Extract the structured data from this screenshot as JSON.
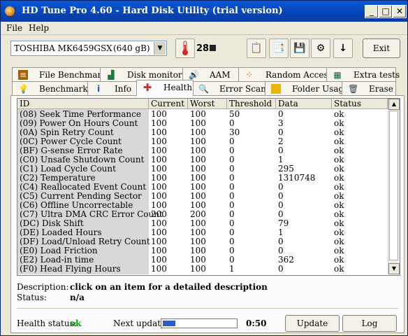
{
  "window": {
    "title": "HD Tune Pro 4.60 - Hard Disk Utility (trial version)"
  },
  "menu": {
    "file": "File",
    "help": "Help"
  },
  "toolbar": {
    "drive_name": "TOSHIBA MK6459GSX",
    "drive_size": "(640 gB)",
    "temperature": "28",
    "temperature_unit_icon": "celsius-icon",
    "exit_label": "Exit"
  },
  "tabs_top": [
    "File Benchmark",
    "Disk monitor",
    "AAM",
    "Random Access",
    "Extra tests"
  ],
  "tabs_bottom": [
    "Benchmark",
    "Info",
    "Health",
    "Error Scan",
    "Folder Usage",
    "Erase"
  ],
  "active_tab": "Health",
  "table": {
    "headers": [
      "ID",
      "Current",
      "Worst",
      "Threshold",
      "Data",
      "Status"
    ],
    "rows": [
      [
        "(08) Seek Time Performance",
        "100",
        "100",
        "50",
        "0",
        "ok"
      ],
      [
        "(09) Power On Hours Count",
        "100",
        "100",
        "0",
        "3",
        "ok"
      ],
      [
        "(0A) Spin Retry Count",
        "100",
        "100",
        "30",
        "0",
        "ok"
      ],
      [
        "(0C) Power Cycle Count",
        "100",
        "100",
        "0",
        "2",
        "ok"
      ],
      [
        "(BF) G-sense Error Rate",
        "100",
        "100",
        "0",
        "0",
        "ok"
      ],
      [
        "(C0) Unsafe Shutdown Count",
        "100",
        "100",
        "0",
        "1",
        "ok"
      ],
      [
        "(C1) Load Cycle Count",
        "100",
        "100",
        "0",
        "295",
        "ok"
      ],
      [
        "(C2) Temperature",
        "100",
        "100",
        "0",
        "1310748",
        "ok"
      ],
      [
        "(C4) Reallocated Event Count",
        "100",
        "100",
        "0",
        "0",
        "ok"
      ],
      [
        "(C5) Current Pending Sector",
        "100",
        "100",
        "0",
        "0",
        "ok"
      ],
      [
        "(C6) Offline Uncorrectable",
        "100",
        "100",
        "0",
        "0",
        "ok"
      ],
      [
        "(C7) Ultra DMA CRC Error Count",
        "200",
        "200",
        "0",
        "0",
        "ok"
      ],
      [
        "(DC) Disk Shift",
        "100",
        "100",
        "0",
        "79",
        "ok"
      ],
      [
        "(DE) Loaded Hours",
        "100",
        "100",
        "0",
        "1",
        "ok"
      ],
      [
        "(DF) Load/Unload Retry Count",
        "100",
        "100",
        "0",
        "0",
        "ok"
      ],
      [
        "(E0) Load Friction",
        "100",
        "100",
        "0",
        "0",
        "ok"
      ],
      [
        "(E2) Load-in time",
        "100",
        "100",
        "0",
        "362",
        "ok"
      ],
      [
        "(F0) Head Flying Hours",
        "100",
        "100",
        "1",
        "0",
        "ok"
      ]
    ]
  },
  "details": {
    "description_label": "Description:",
    "description_value": "click on an item for a detailed description",
    "status_label": "Status:",
    "status_value": "n/a"
  },
  "footer": {
    "health_label": "Health status:",
    "health_value": "ok",
    "health_color": "#00aa00",
    "next_update_label": "Next update:",
    "next_update_progress": 0.17,
    "countdown": "0:50",
    "update_label": "Update",
    "log_label": "Log"
  }
}
